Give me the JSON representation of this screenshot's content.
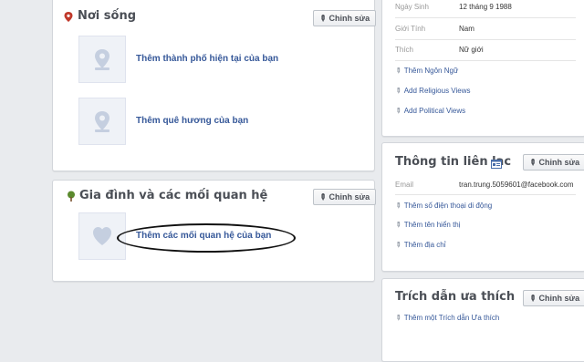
{
  "edit_label": "Chỉnh sửa",
  "places": {
    "title": "Nơi sống",
    "items": [
      {
        "label": "Thêm thành phố hiện tại của bạn",
        "icon": "map-pin-icon"
      },
      {
        "label": "Thêm quê hương của bạn",
        "icon": "map-pin-icon"
      }
    ]
  },
  "family": {
    "title": "Gia đình và các mối quan hệ",
    "items": [
      {
        "label": "Thêm các mối quan hệ của bạn",
        "icon": "heart-icon"
      }
    ]
  },
  "basic_info": {
    "rows": [
      {
        "label": "Ngày Sinh",
        "value": "12 tháng 9 1988"
      },
      {
        "label": "Giới Tính",
        "value": "Nam"
      },
      {
        "label": "Thích",
        "value": "Nữ giới"
      }
    ],
    "links": [
      "Thêm Ngôn Ngữ",
      "Add Religious Views",
      "Add Political Views"
    ]
  },
  "contact": {
    "title": "Thông tin liên lạc",
    "email_label": "Email",
    "email_value": "tran.trung.5059601@facebook.com",
    "links": [
      "Thêm số điện thoại di động",
      "Thêm tên hiển thị",
      "Thêm địa chỉ"
    ]
  },
  "quotes": {
    "title": "Trích dẫn ưa thích",
    "link": "Thêm một Trích dẫn Ưa thích"
  },
  "colors": {
    "link": "#365899",
    "background": "#e9ebee",
    "accent_red": "#c0392b",
    "accent_green": "#5b8a2e"
  }
}
